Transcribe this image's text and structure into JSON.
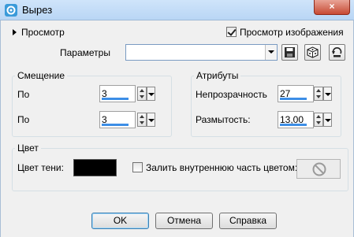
{
  "window": {
    "title": "Вырез",
    "close_glyph": "×",
    "icon": "corel-app-icon",
    "accent_color": "#3d8ee6"
  },
  "preview": {
    "toggle_label": "Просмотр",
    "image_preview_label": "Просмотр изображения",
    "image_preview_checked": true
  },
  "parameters": {
    "label": "Параметры",
    "preset_value": "",
    "icons": [
      "save-preset-icon",
      "randomize-dice-icon",
      "reset-icon"
    ]
  },
  "offset": {
    "title": "Смещение",
    "horizontal_label": "По",
    "horizontal_value": "3",
    "vertical_label": "По",
    "vertical_value": "3"
  },
  "attributes": {
    "title": "Атрибуты",
    "opacity_label": "Непрозрачность",
    "opacity_value": "27",
    "blur_label": "Размытость:",
    "blur_value": "13,00"
  },
  "color": {
    "title": "Цвет",
    "shadow_label": "Цвет тени:",
    "shadow_color": "#000000",
    "fill_inside_label": "Залить внутреннюю часть цветом:",
    "fill_inside_checked": false
  },
  "buttons": {
    "ok": "OK",
    "cancel": "Отмена",
    "help": "Справка"
  }
}
